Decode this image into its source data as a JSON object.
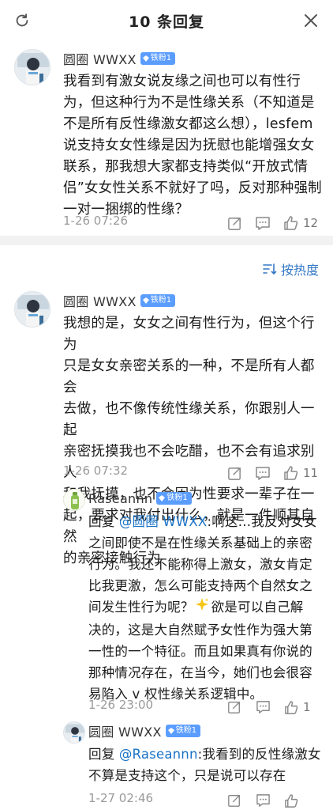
{
  "header": {
    "title": "10 条回复",
    "refresh_icon": "refresh-icon",
    "close_icon": "close-icon"
  },
  "colors": {
    "accent": "#3478c6",
    "badge": "#5b9dff",
    "divider": "#f2f2f2"
  },
  "main_comment": {
    "author": "圆圈 WWXX",
    "badge": "铁粉1",
    "text_lines": [
      "我看到有激女说友缘之间也可以有性行",
      "为，但这种行为不是性缘关系（不知道是",
      "不是所有反性缘激女都这么想），lesfem",
      "说支持女女性缘是因为抚慰也能增强女女",
      "联系，那我想大家都支持类似“开放式情",
      "侣”女女性关系不就好了吗，反对那种强制",
      "一对一捆绑的性缘？"
    ],
    "time": "1-26 07:26",
    "likes": "12"
  },
  "sort": {
    "label": "按热度",
    "icon": "sort-icon"
  },
  "reply1": {
    "author": "圆圈 WWXX",
    "badge": "铁粉1",
    "text_lines": [
      "我想的是，女女之间有性行为，但这个行为",
      "只是女女亲密关系的一种，不是所有人都会",
      "去做，也不像传统性缘关系，你跟别人一起",
      "亲密抚摸我也不会吃醋，也不会有追求别人",
      "和我抚摸，也不会因为性要求一辈子在一",
      "起，要求对我付出什么，就是一件顺其自然",
      "的亲密接触行为"
    ],
    "time": "1-26 07:32",
    "likes": "11"
  },
  "reply2": {
    "author": "Raseannn",
    "badge": "铁粉1",
    "prefix": "回复 ",
    "mention": "@圆圈 WWXX",
    "text_lines": [
      ":啊这…我反对女女",
      "之间即使不是在性缘关系基础上的亲密",
      "行为。我还不能称得上激女，激女肯定",
      "比我更激，怎么可能支持两个自然女之",
      "间发生性行为呢？",
      "欲是可以自己解",
      "决的，这是大自然赋予女性作为强大第",
      "一性的一个特征。而且如果真有你说的",
      "那种情况存在，在当今，她们也会很容",
      "易陷入 v 权性缘关系逻辑中。"
    ],
    "time": "1-26 23:00",
    "likes": "1"
  },
  "reply3": {
    "author": "圆圈 WWXX",
    "badge": "铁粉1",
    "prefix": "回复 ",
    "mention": "@Raseannn",
    "text_lines": [
      ":我看到的反性缘激女",
      "不算是支持这个，只是说可以存在"
    ],
    "time": "1-27 02:46"
  }
}
